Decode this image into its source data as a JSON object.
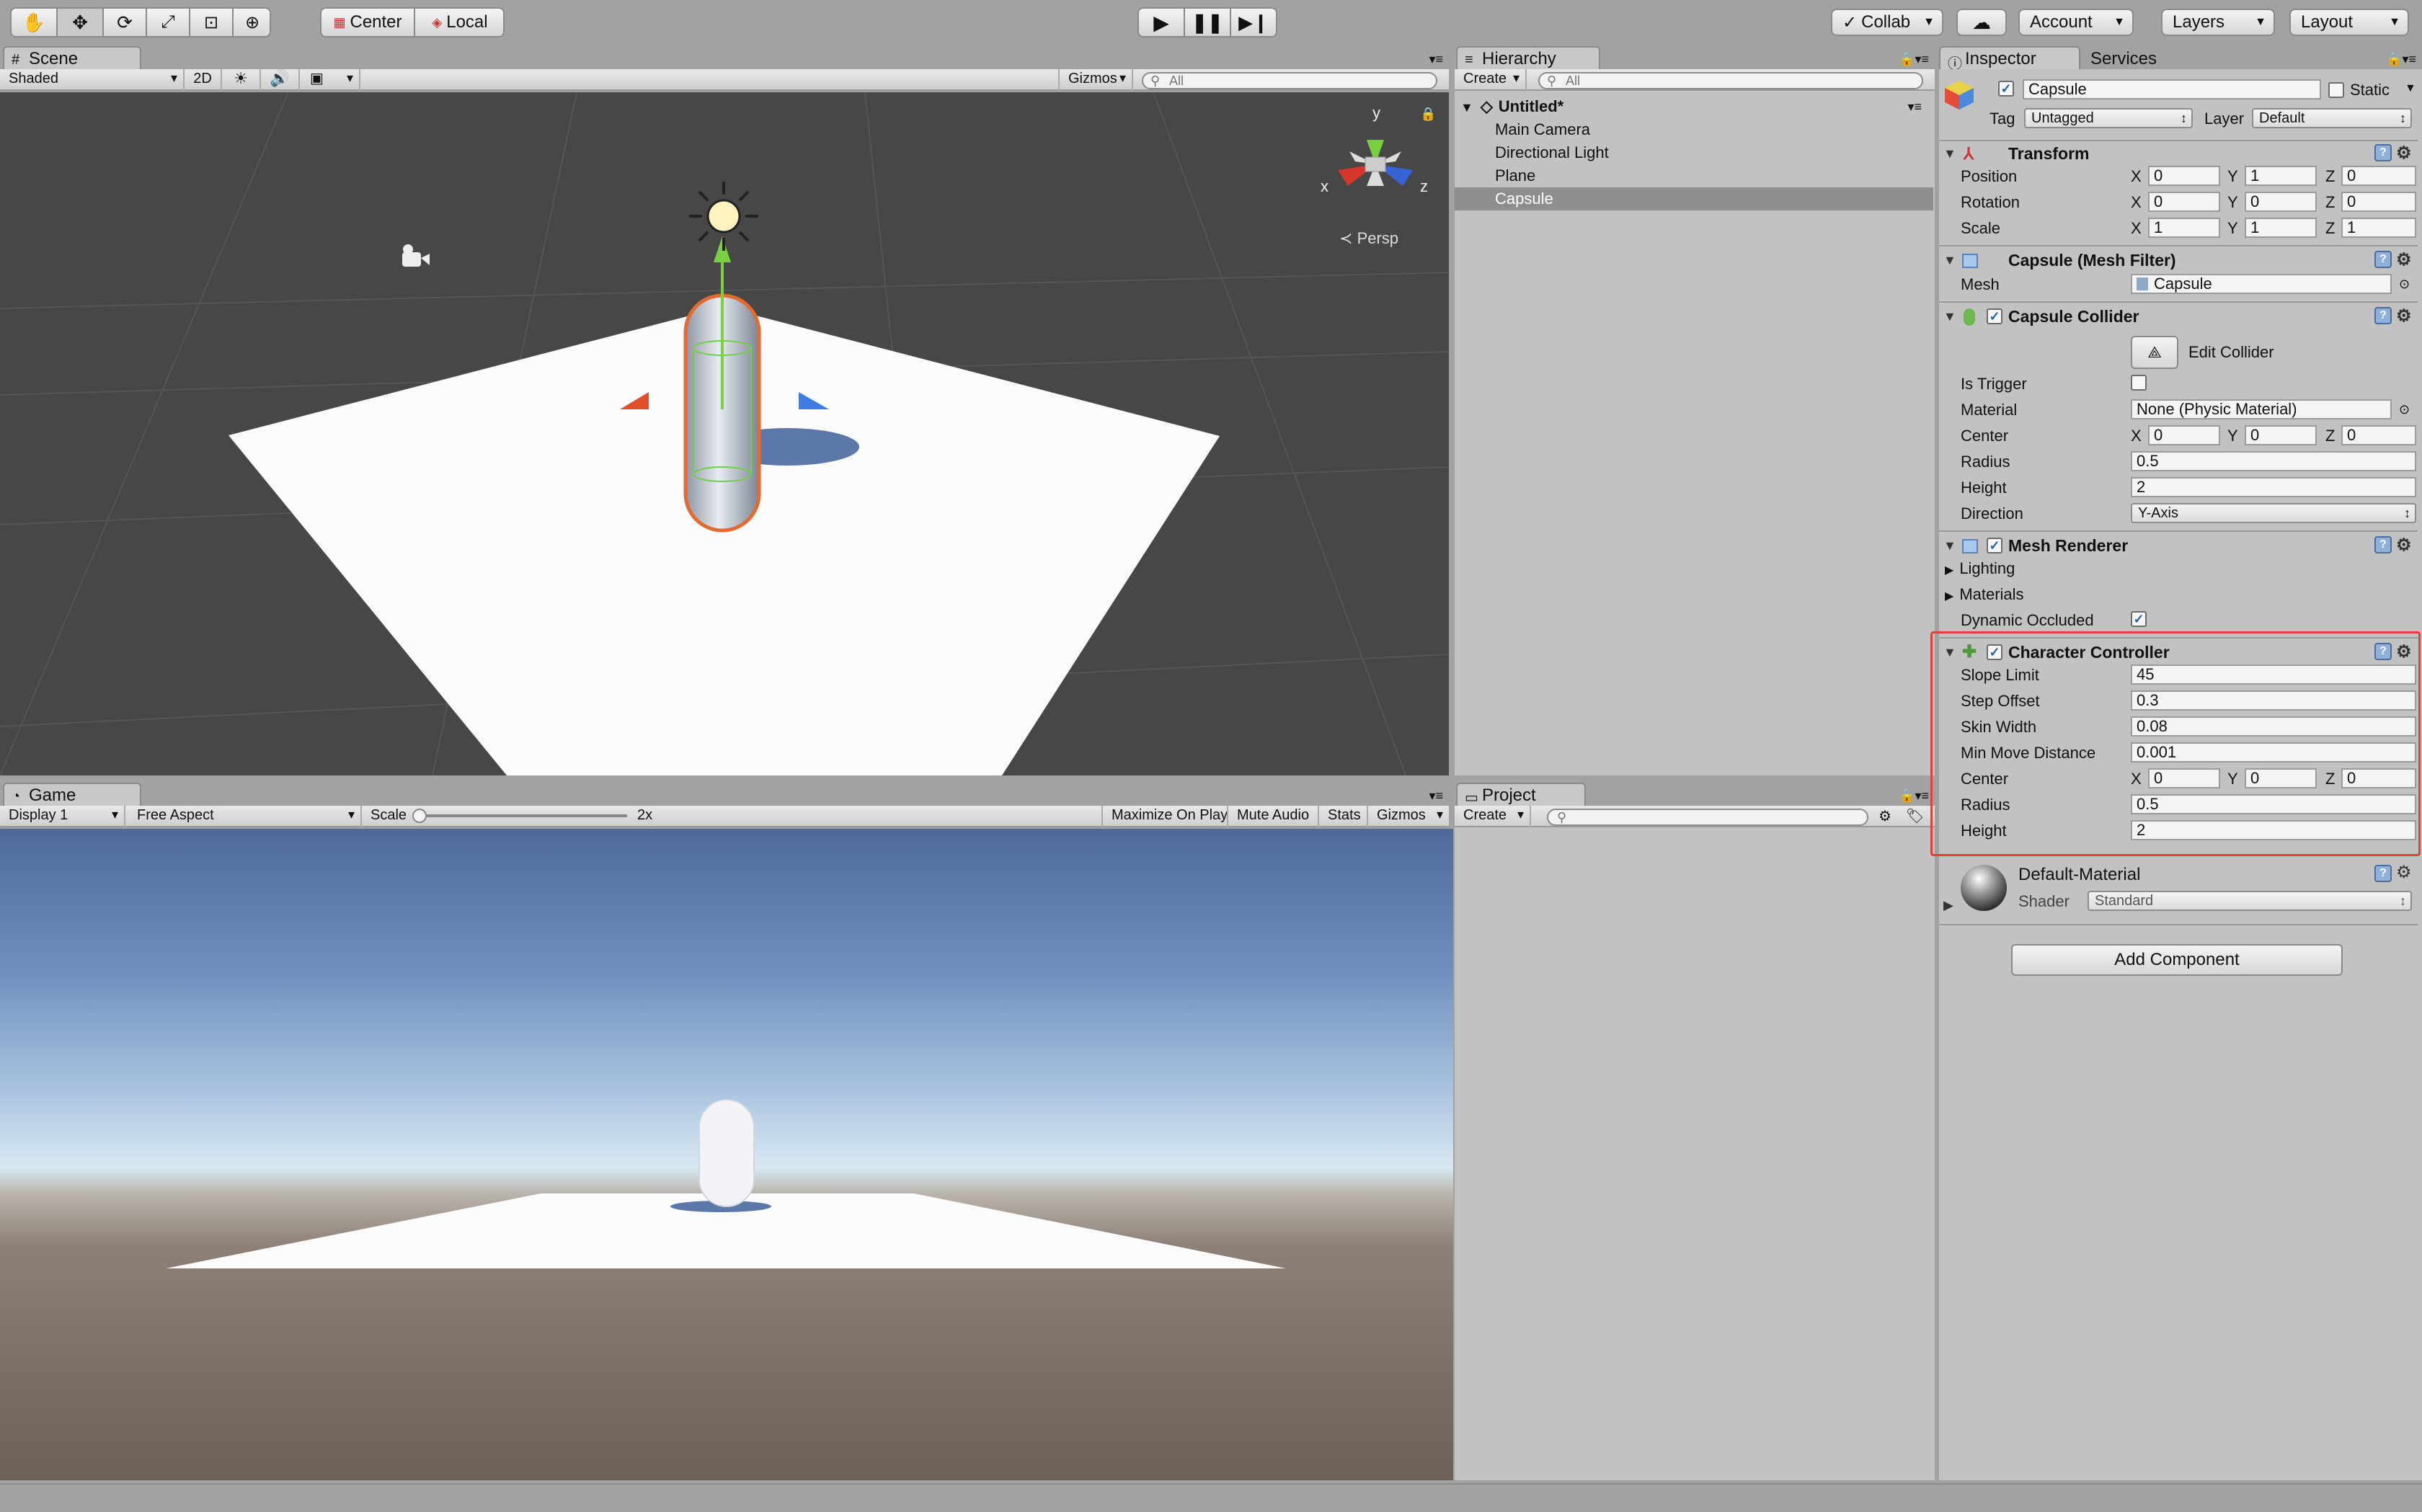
{
  "toolbar": {
    "tools": [
      "hand-icon",
      "move-icon",
      "rotate-icon",
      "scale-icon",
      "rect-tool-icon",
      "transform-icon"
    ],
    "pivot": "Center",
    "space": "Local",
    "collab": "Collab",
    "account": "Account",
    "layers": "Layers",
    "layout": "Layout"
  },
  "scene": {
    "tab": "Scene",
    "shading": "Shaded",
    "mode2d": "2D",
    "gizmos": "Gizmos",
    "search_placeholder": "All",
    "persp": "Persp",
    "axes": {
      "x": "x",
      "y": "y",
      "z": "z"
    }
  },
  "hierarchy": {
    "tab": "Hierarchy",
    "create": "Create",
    "search_placeholder": "All",
    "scene_name": "Untitled*",
    "items": [
      "Main Camera",
      "Directional Light",
      "Plane",
      "Capsule"
    ]
  },
  "game": {
    "tab": "Game",
    "display": "Display 1",
    "aspect": "Free Aspect",
    "scale_label": "Scale",
    "scale_value": "2x",
    "maximize": "Maximize On Play",
    "mute": "Mute Audio",
    "stats": "Stats",
    "gizmos": "Gizmos"
  },
  "project": {
    "tab": "Project",
    "create": "Create"
  },
  "inspector": {
    "tab": "Inspector",
    "services_tab": "Services",
    "object_name": "Capsule",
    "static_label": "Static",
    "tag_label": "Tag",
    "tag_value": "Untagged",
    "layer_label": "Layer",
    "layer_value": "Default",
    "transform": {
      "title": "Transform",
      "position_label": "Position",
      "rotation_label": "Rotation",
      "scale_label": "Scale",
      "position": [
        "0",
        "1",
        "0"
      ],
      "rotation": [
        "0",
        "0",
        "0"
      ],
      "scale": [
        "1",
        "1",
        "1"
      ]
    },
    "mesh_filter": {
      "title": "Capsule (Mesh Filter)",
      "mesh_label": "Mesh",
      "mesh_value": "Capsule"
    },
    "capsule_collider": {
      "title": "Capsule Collider",
      "edit_collider": "Edit Collider",
      "is_trigger_label": "Is Trigger",
      "material_label": "Material",
      "material_value": "None (Physic Material)",
      "center_label": "Center",
      "center": [
        "0",
        "0",
        "0"
      ],
      "radius_label": "Radius",
      "radius": "0.5",
      "height_label": "Height",
      "height": "2",
      "direction_label": "Direction",
      "direction": "Y-Axis"
    },
    "mesh_renderer": {
      "title": "Mesh Renderer",
      "lighting": "Lighting",
      "materials": "Materials",
      "dynamic_occluded": "Dynamic Occluded"
    },
    "character_controller": {
      "title": "Character Controller",
      "slope_limit_label": "Slope Limit",
      "slope_limit": "45",
      "step_offset_label": "Step Offset",
      "step_offset": "0.3",
      "skin_width_label": "Skin Width",
      "skin_width": "0.08",
      "min_move_label": "Min Move Distance",
      "min_move": "0.001",
      "center_label": "Center",
      "center": [
        "0",
        "0",
        "0"
      ],
      "radius_label": "Radius",
      "radius": "0.5",
      "height_label": "Height",
      "height": "2"
    },
    "material": {
      "name": "Default-Material",
      "shader_label": "Shader",
      "shader_value": "Standard"
    },
    "add_component": "Add Component"
  },
  "colors": {
    "highlight": "#e0413a",
    "selection": "#8e8e8e",
    "scene_bg": "#474747",
    "accent": "#3b6fc2"
  }
}
